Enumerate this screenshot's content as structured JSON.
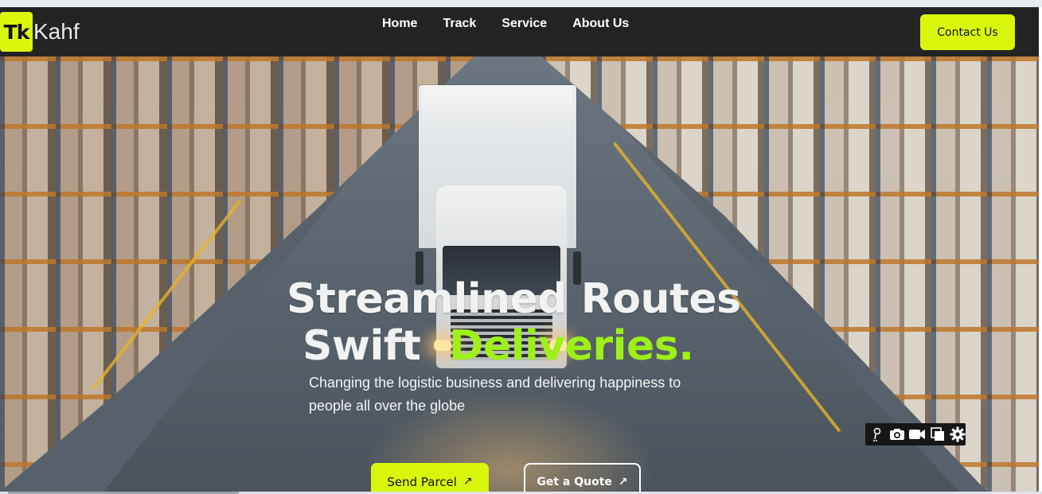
{
  "brand": {
    "mark": "Tk",
    "name": "Kahf"
  },
  "nav": {
    "items": [
      {
        "label": "Home"
      },
      {
        "label": "Track"
      },
      {
        "label": "Service"
      },
      {
        "label": "About Us"
      }
    ],
    "contact_label": "Contact Us"
  },
  "hero": {
    "title_line1": "Streamlined Routes",
    "title_line2_word1": "Swift",
    "title_line2_word2": "Deliveries.",
    "subtitle": "Changing the logistic business and delivering happiness to people all over the globe",
    "send_button": "Send Parcel",
    "quote_button": "Get a Quote",
    "arrow_glyph": "↗"
  },
  "media_toolbar": {
    "icons": [
      "pin-icon",
      "camera-icon",
      "video-icon",
      "copy-icon",
      "gear-icon"
    ]
  },
  "colors": {
    "accent": "#d9f70c",
    "highlight_text": "#9ef01a",
    "navbar_bg": "#232323"
  }
}
